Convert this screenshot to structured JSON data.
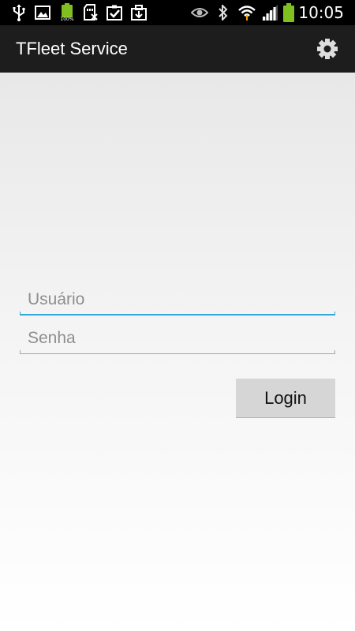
{
  "status_bar": {
    "time": "10:05",
    "battery_notification_text": "100%",
    "icons": [
      "usb-icon",
      "image-icon",
      "battery-full-icon",
      "sd-card-icon",
      "clipboard-check-icon",
      "briefcase-icon",
      "eye-icon",
      "bluetooth-icon",
      "wifi-icon",
      "signal-icon",
      "battery-icon"
    ],
    "battery_color": "#7fbf1f"
  },
  "action_bar": {
    "title": "TFleet Service",
    "settings_icon": "gear-icon"
  },
  "form": {
    "username": {
      "placeholder": "Usuário",
      "value": ""
    },
    "password": {
      "placeholder": "Senha",
      "value": ""
    },
    "login_label": "Login"
  },
  "colors": {
    "focus_accent": "#33a8d8",
    "action_bar": "#1d1d1d",
    "button_bg": "#d6d6d6"
  }
}
